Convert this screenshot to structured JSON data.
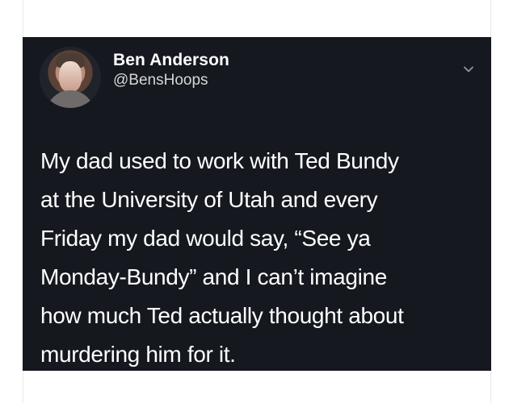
{
  "colors": {
    "page_background": "#ffffff",
    "tweet_background": "#15181f",
    "primary_text": "#ffffff",
    "secondary_text": "#d6d6d6",
    "chevron": "#8b98a5"
  },
  "tweet": {
    "author": {
      "display_name": "Ben Anderson",
      "handle": "@BensHoops",
      "avatar_icon": "avatar-icon"
    },
    "menu_icon": "chevron-down-icon",
    "text_lines": [
      "My dad used to work with Ted Bundy",
      "at the University of Utah and every",
      "Friday my dad would say, “See ya",
      "Monday-Bundy” and I can’t imagine",
      "how much Ted actually thought about",
      "murdering him for it."
    ]
  }
}
